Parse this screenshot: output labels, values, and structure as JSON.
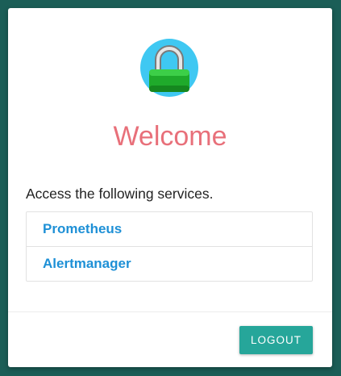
{
  "header": {
    "logo_icon": "padlock-icon",
    "title": "Welcome"
  },
  "main": {
    "subtitle": "Access the following services.",
    "services": [
      {
        "label": "Prometheus"
      },
      {
        "label": "Alertmanager"
      }
    ]
  },
  "footer": {
    "logout_label": "LOGOUT"
  },
  "colors": {
    "background": "#1b5e57",
    "title": "#e8707a",
    "link": "#1e90d6",
    "button": "#26a69a"
  }
}
